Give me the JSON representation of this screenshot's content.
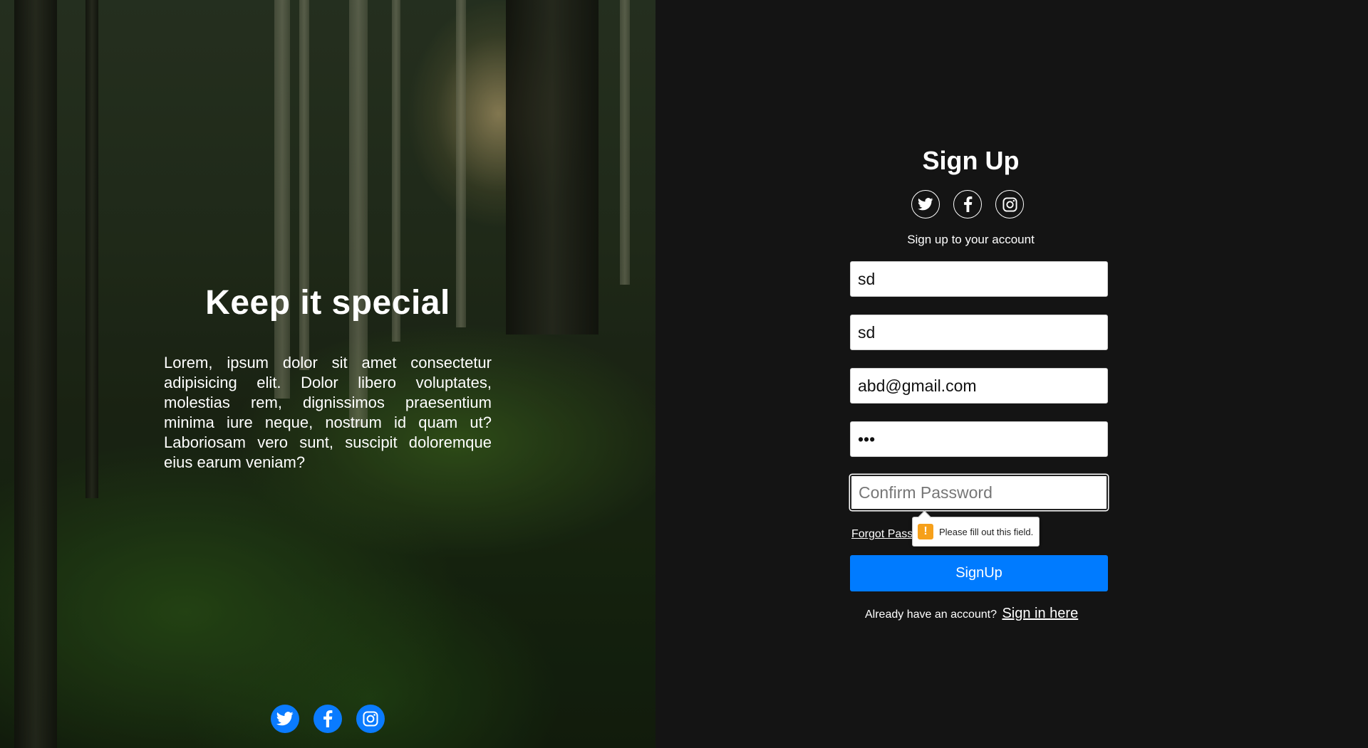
{
  "hero": {
    "title": "Keep it special",
    "text": "Lorem, ipsum dolor sit amet consectetur adipisicing elit. Dolor libero voluptates, molestias rem, dignissimos praesentium minima iure neque, nostrum id quam ut? Laboriosam vero sunt, suscipit doloremque eius earum veniam?",
    "social": [
      "twitter-icon",
      "facebook-icon",
      "instagram-icon"
    ],
    "accent": "#007bff"
  },
  "form": {
    "title": "Sign Up",
    "social": [
      "twitter-icon",
      "facebook-icon",
      "instagram-icon"
    ],
    "subtitle": "Sign up to your account",
    "fields": [
      {
        "value": "sd"
      },
      {
        "value": "sd"
      },
      {
        "value": "abd@gmail.com"
      },
      {
        "value": "•••"
      },
      {
        "value": "",
        "placeholder": "Confirm Password"
      }
    ],
    "forgot_label": "Forgot Password?",
    "validation_message": "Please fill out this field.",
    "submit_label": "SignUp",
    "signin_prompt": "Already have an account?",
    "signin_link": "Sign in here",
    "background": "#141414",
    "button_color": "#007bff"
  }
}
